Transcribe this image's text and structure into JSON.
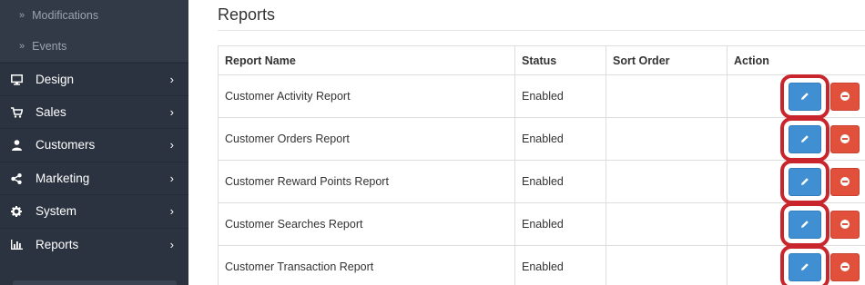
{
  "sidebar": {
    "sub_items": [
      {
        "label": "Modifications",
        "icon": "double-chevron-right-icon"
      },
      {
        "label": "Events",
        "icon": "double-chevron-right-icon"
      }
    ],
    "items": [
      {
        "label": "Design",
        "icon": "monitor-icon"
      },
      {
        "label": "Sales",
        "icon": "cart-icon"
      },
      {
        "label": "Customers",
        "icon": "user-icon"
      },
      {
        "label": "Marketing",
        "icon": "share-icon"
      },
      {
        "label": "System",
        "icon": "gear-icon"
      },
      {
        "label": "Reports",
        "icon": "bar-chart-icon"
      }
    ]
  },
  "main": {
    "title": "Reports",
    "table": {
      "headers": {
        "name": "Report Name",
        "status": "Status",
        "sort_order": "Sort Order",
        "action": "Action"
      },
      "rows": [
        {
          "name": "Customer Activity Report",
          "status": "Enabled",
          "sort_order": ""
        },
        {
          "name": "Customer Orders Report",
          "status": "Enabled",
          "sort_order": ""
        },
        {
          "name": "Customer Reward Points Report",
          "status": "Enabled",
          "sort_order": ""
        },
        {
          "name": "Customer Searches Report",
          "status": "Enabled",
          "sort_order": ""
        },
        {
          "name": "Customer Transaction Report",
          "status": "Enabled",
          "sort_order": ""
        }
      ]
    }
  },
  "colors": {
    "sidebar_bg": "#2c3340",
    "edit_button": "#3f8fd2",
    "delete_button": "#e0503a",
    "highlight_box": "#c8262c"
  }
}
